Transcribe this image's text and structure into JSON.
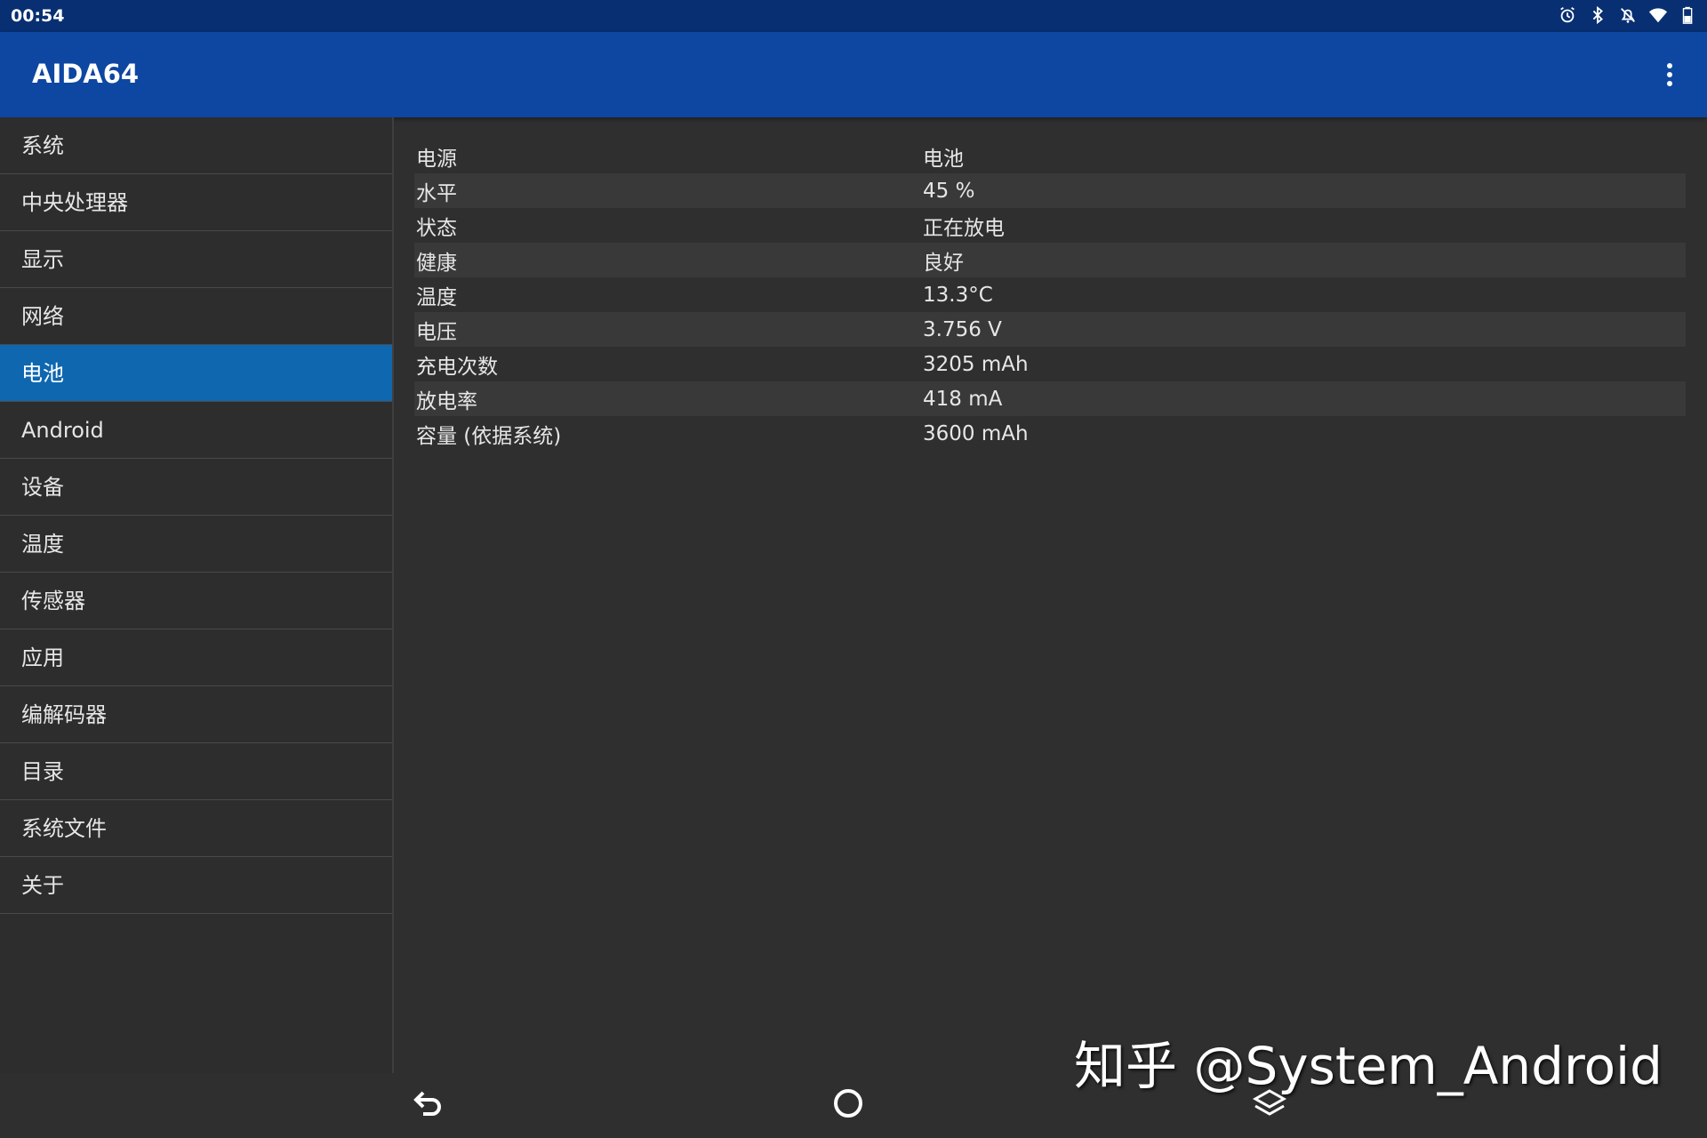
{
  "status_bar": {
    "time": "00:54",
    "icons": [
      "alarm-icon",
      "bluetooth-icon",
      "notifications-off-icon",
      "wifi-icon",
      "battery-icon"
    ]
  },
  "app_bar": {
    "title": "AIDA64",
    "menu_icon": "more-vert-icon"
  },
  "sidebar": {
    "items": [
      {
        "label": "系统"
      },
      {
        "label": "中央处理器"
      },
      {
        "label": "显示"
      },
      {
        "label": "网络"
      },
      {
        "label": "电池",
        "active": true
      },
      {
        "label": "Android"
      },
      {
        "label": "设备"
      },
      {
        "label": "温度"
      },
      {
        "label": "传感器"
      },
      {
        "label": "应用"
      },
      {
        "label": "编解码器"
      },
      {
        "label": "目录"
      },
      {
        "label": "系统文件"
      },
      {
        "label": "关于"
      }
    ]
  },
  "battery_info": {
    "rows": [
      {
        "label": "电源",
        "value": "电池"
      },
      {
        "label": "水平",
        "value": "45 %"
      },
      {
        "label": "状态",
        "value": "正在放电"
      },
      {
        "label": "健康",
        "value": "良好"
      },
      {
        "label": "温度",
        "value": "13.3°C"
      },
      {
        "label": "电压",
        "value": "3.756 V"
      },
      {
        "label": "充电次数",
        "value": "3205 mAh"
      },
      {
        "label": "放电率",
        "value": "418 mA"
      },
      {
        "label": "容量 (依据系统)",
        "value": "3600 mAh"
      }
    ]
  },
  "nav_bar": {
    "buttons": [
      "back-icon",
      "home-icon",
      "recents-icon"
    ]
  },
  "watermark": "知乎 @System_Android",
  "colors": {
    "status_bar": "#082f72",
    "app_bar": "#0d47a1",
    "active_item": "#0f67b0",
    "background": "#2f2f2f",
    "alt_row": "#393939"
  }
}
